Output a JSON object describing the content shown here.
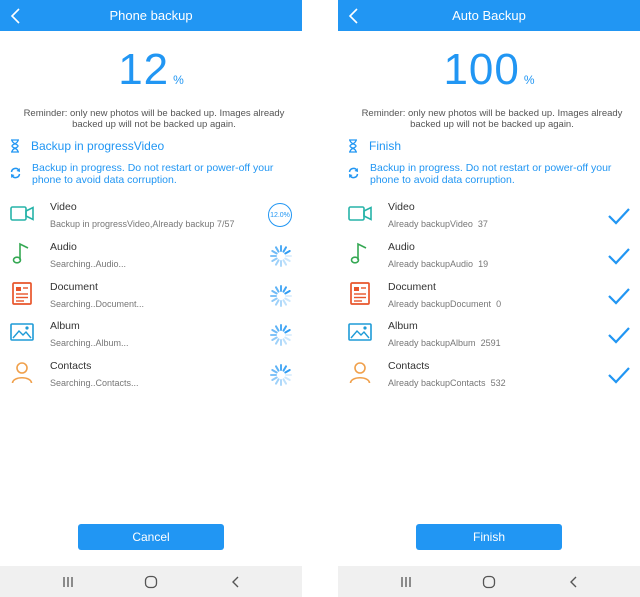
{
  "left": {
    "title": "Phone backup",
    "progress_number": "12",
    "progress_fraction": 0.12,
    "percent_sign": "%",
    "reminder": "Reminder: only new photos will be backed up. Images already backed up will not be backed up again.",
    "status_line": "Backup in progressVideo",
    "warning": "Backup in progress. Do not restart or power-off your phone to avoid data corruption.",
    "items": [
      {
        "name": "Video",
        "sub": "Backup in progressVideo,Already backup 7/57",
        "state": "progress-ring",
        "ring_text": "12.0%"
      },
      {
        "name": "Audio",
        "sub": "Searching..Audio...",
        "state": "spinner"
      },
      {
        "name": "Document",
        "sub": "Searching..Document...",
        "state": "spinner"
      },
      {
        "name": "Album",
        "sub": "Searching..Album...",
        "state": "spinner"
      },
      {
        "name": "Contacts",
        "sub": "Searching..Contacts...",
        "state": "spinner"
      }
    ],
    "button": "Cancel"
  },
  "right": {
    "title": "Auto Backup",
    "progress_number": "100",
    "progress_fraction": 1.0,
    "percent_sign": "%",
    "reminder": "Reminder: only new photos will be backed up. Images already backed up will not be backed up again.",
    "status_line": "Finish",
    "warning": "Backup in progress. Do not restart or power-off your phone to avoid data corruption.",
    "items": [
      {
        "name": "Video",
        "sub": "Already backupVideo",
        "count": "37",
        "state": "check"
      },
      {
        "name": "Audio",
        "sub": "Already backupAudio",
        "count": "19",
        "state": "check"
      },
      {
        "name": "Document",
        "sub": "Already backupDocument",
        "count": "0",
        "state": "check"
      },
      {
        "name": "Album",
        "sub": "Already backupAlbum",
        "count": "2591",
        "state": "check"
      },
      {
        "name": "Contacts",
        "sub": "Already backupContacts",
        "count": "532",
        "state": "check"
      }
    ],
    "button": "Finish"
  },
  "colors": {
    "accent": "#2196f3",
    "video_icon": "#26b3a8",
    "audio_icon": "#35a853",
    "document_icon": "#e8552b",
    "album_icon": "#1e9bd7",
    "contacts_icon": "#f0a04b"
  },
  "icons": {
    "back": "back-arrow-icon",
    "hourglass": "hourglass-icon",
    "sync": "sync-icon",
    "video": "video-camera-icon",
    "audio": "music-note-icon",
    "document": "document-icon",
    "album": "image-icon",
    "contacts": "person-icon",
    "check": "checkmark-icon",
    "spinner": "spinner-icon",
    "nav_recent": "recent-apps-icon",
    "nav_home": "home-icon",
    "nav_back": "back-icon"
  }
}
